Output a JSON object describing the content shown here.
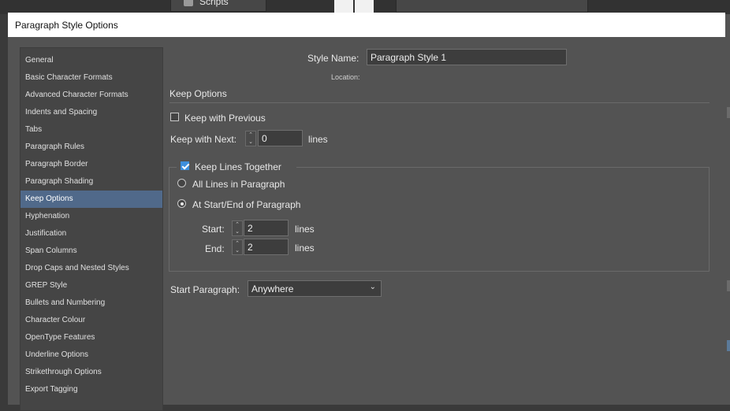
{
  "background": {
    "scripts_label": "Scripts"
  },
  "window": {
    "title": "Paragraph Style Options"
  },
  "sidebar": {
    "items": [
      {
        "label": "General"
      },
      {
        "label": "Basic Character Formats"
      },
      {
        "label": "Advanced Character Formats"
      },
      {
        "label": "Indents and Spacing"
      },
      {
        "label": "Tabs"
      },
      {
        "label": "Paragraph Rules"
      },
      {
        "label": "Paragraph Border"
      },
      {
        "label": "Paragraph Shading"
      },
      {
        "label": "Keep Options",
        "selected": true
      },
      {
        "label": "Hyphenation"
      },
      {
        "label": "Justification"
      },
      {
        "label": "Span Columns"
      },
      {
        "label": "Drop Caps and Nested Styles"
      },
      {
        "label": "GREP Style"
      },
      {
        "label": "Bullets and Numbering"
      },
      {
        "label": "Character Colour"
      },
      {
        "label": "OpenType Features"
      },
      {
        "label": "Underline Options"
      },
      {
        "label": "Strikethrough Options"
      },
      {
        "label": "Export Tagging"
      }
    ]
  },
  "main": {
    "style_name_label": "Style Name:",
    "style_name_value": "Paragraph Style 1",
    "location_label": "Location:",
    "section_title": "Keep Options",
    "keep_with_previous": {
      "label": "Keep with Previous",
      "checked": false
    },
    "keep_with_next": {
      "label": "Keep with Next:",
      "value": "0",
      "unit": "lines"
    },
    "keep_lines_together": {
      "label": "Keep Lines Together",
      "checked": true
    },
    "all_lines": {
      "label": "All Lines in Paragraph",
      "checked": false
    },
    "at_start_end": {
      "label": "At Start/End of Paragraph",
      "checked": true
    },
    "start": {
      "label": "Start:",
      "value": "2",
      "unit": "lines"
    },
    "end": {
      "label": "End:",
      "value": "2",
      "unit": "lines"
    },
    "start_paragraph": {
      "label": "Start Paragraph:",
      "value": "Anywhere"
    }
  },
  "colors": {
    "dialog_bg": "#535353",
    "selected_item": "#50698a",
    "checkbox_checked": "#3e8fdc"
  },
  "icons": {
    "stepper": "up-down-arrows-icon",
    "dropdown": "chevron-down-icon",
    "scripts": "scripts-icon"
  }
}
